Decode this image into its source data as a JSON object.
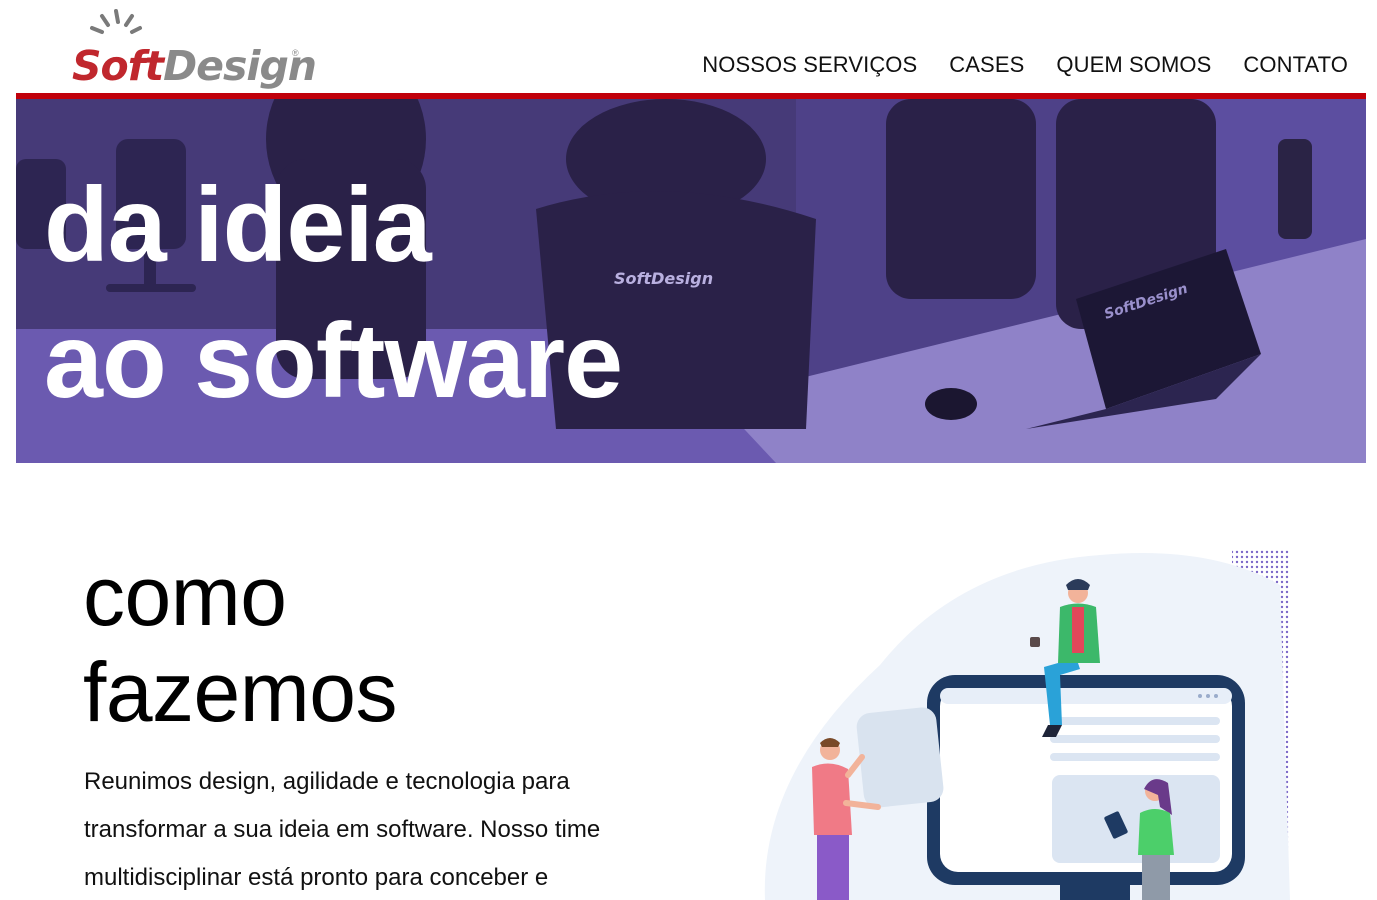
{
  "brand": {
    "name_part1": "Soft",
    "name_part2": "Design",
    "registered": "®",
    "colors": {
      "red": "#c0272d",
      "gray": "#8a8a8a",
      "accent_bar": "#c0000b",
      "hero_overlay": "#5a4a9e"
    }
  },
  "nav": {
    "items": [
      {
        "label": "NOSSOS SERVIÇOS"
      },
      {
        "label": "CASES"
      },
      {
        "label": "QUEM SOMOS"
      },
      {
        "label": "CONTATO"
      }
    ]
  },
  "hero": {
    "line1": "da ideia",
    "line2": "ao software",
    "shirt_logo": "SoftDesign",
    "laptop_logo": "SoftDesign"
  },
  "section": {
    "title_line1": "como",
    "title_line2": "fazemos",
    "text": "Reunimos design, agilidade e tecnologia para transformar a sua ideia em software. Nosso time multidisciplinar está pronto para conceber e"
  },
  "icons": [
    "logo-rays-icon",
    "people-illustration"
  ]
}
